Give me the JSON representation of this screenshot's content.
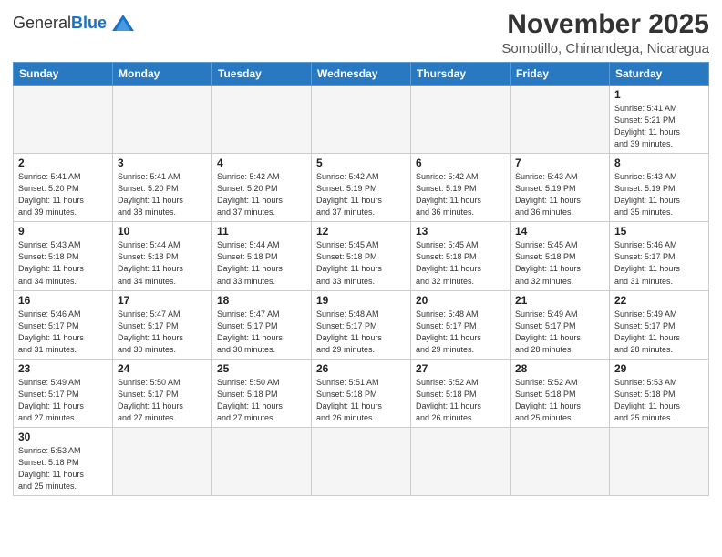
{
  "header": {
    "logo_general": "General",
    "logo_blue": "Blue",
    "title": "November 2025",
    "subtitle": "Somotillo, Chinandega, Nicaragua"
  },
  "weekdays": [
    "Sunday",
    "Monday",
    "Tuesday",
    "Wednesday",
    "Thursday",
    "Friday",
    "Saturday"
  ],
  "weeks": [
    [
      {
        "day": "",
        "info": ""
      },
      {
        "day": "",
        "info": ""
      },
      {
        "day": "",
        "info": ""
      },
      {
        "day": "",
        "info": ""
      },
      {
        "day": "",
        "info": ""
      },
      {
        "day": "",
        "info": ""
      },
      {
        "day": "1",
        "info": "Sunrise: 5:41 AM\nSunset: 5:21 PM\nDaylight: 11 hours\nand 39 minutes."
      }
    ],
    [
      {
        "day": "2",
        "info": "Sunrise: 5:41 AM\nSunset: 5:20 PM\nDaylight: 11 hours\nand 39 minutes."
      },
      {
        "day": "3",
        "info": "Sunrise: 5:41 AM\nSunset: 5:20 PM\nDaylight: 11 hours\nand 38 minutes."
      },
      {
        "day": "4",
        "info": "Sunrise: 5:42 AM\nSunset: 5:20 PM\nDaylight: 11 hours\nand 37 minutes."
      },
      {
        "day": "5",
        "info": "Sunrise: 5:42 AM\nSunset: 5:19 PM\nDaylight: 11 hours\nand 37 minutes."
      },
      {
        "day": "6",
        "info": "Sunrise: 5:42 AM\nSunset: 5:19 PM\nDaylight: 11 hours\nand 36 minutes."
      },
      {
        "day": "7",
        "info": "Sunrise: 5:43 AM\nSunset: 5:19 PM\nDaylight: 11 hours\nand 36 minutes."
      },
      {
        "day": "8",
        "info": "Sunrise: 5:43 AM\nSunset: 5:19 PM\nDaylight: 11 hours\nand 35 minutes."
      }
    ],
    [
      {
        "day": "9",
        "info": "Sunrise: 5:43 AM\nSunset: 5:18 PM\nDaylight: 11 hours\nand 34 minutes."
      },
      {
        "day": "10",
        "info": "Sunrise: 5:44 AM\nSunset: 5:18 PM\nDaylight: 11 hours\nand 34 minutes."
      },
      {
        "day": "11",
        "info": "Sunrise: 5:44 AM\nSunset: 5:18 PM\nDaylight: 11 hours\nand 33 minutes."
      },
      {
        "day": "12",
        "info": "Sunrise: 5:45 AM\nSunset: 5:18 PM\nDaylight: 11 hours\nand 33 minutes."
      },
      {
        "day": "13",
        "info": "Sunrise: 5:45 AM\nSunset: 5:18 PM\nDaylight: 11 hours\nand 32 minutes."
      },
      {
        "day": "14",
        "info": "Sunrise: 5:45 AM\nSunset: 5:18 PM\nDaylight: 11 hours\nand 32 minutes."
      },
      {
        "day": "15",
        "info": "Sunrise: 5:46 AM\nSunset: 5:17 PM\nDaylight: 11 hours\nand 31 minutes."
      }
    ],
    [
      {
        "day": "16",
        "info": "Sunrise: 5:46 AM\nSunset: 5:17 PM\nDaylight: 11 hours\nand 31 minutes."
      },
      {
        "day": "17",
        "info": "Sunrise: 5:47 AM\nSunset: 5:17 PM\nDaylight: 11 hours\nand 30 minutes."
      },
      {
        "day": "18",
        "info": "Sunrise: 5:47 AM\nSunset: 5:17 PM\nDaylight: 11 hours\nand 30 minutes."
      },
      {
        "day": "19",
        "info": "Sunrise: 5:48 AM\nSunset: 5:17 PM\nDaylight: 11 hours\nand 29 minutes."
      },
      {
        "day": "20",
        "info": "Sunrise: 5:48 AM\nSunset: 5:17 PM\nDaylight: 11 hours\nand 29 minutes."
      },
      {
        "day": "21",
        "info": "Sunrise: 5:49 AM\nSunset: 5:17 PM\nDaylight: 11 hours\nand 28 minutes."
      },
      {
        "day": "22",
        "info": "Sunrise: 5:49 AM\nSunset: 5:17 PM\nDaylight: 11 hours\nand 28 minutes."
      }
    ],
    [
      {
        "day": "23",
        "info": "Sunrise: 5:49 AM\nSunset: 5:17 PM\nDaylight: 11 hours\nand 27 minutes."
      },
      {
        "day": "24",
        "info": "Sunrise: 5:50 AM\nSunset: 5:17 PM\nDaylight: 11 hours\nand 27 minutes."
      },
      {
        "day": "25",
        "info": "Sunrise: 5:50 AM\nSunset: 5:18 PM\nDaylight: 11 hours\nand 27 minutes."
      },
      {
        "day": "26",
        "info": "Sunrise: 5:51 AM\nSunset: 5:18 PM\nDaylight: 11 hours\nand 26 minutes."
      },
      {
        "day": "27",
        "info": "Sunrise: 5:52 AM\nSunset: 5:18 PM\nDaylight: 11 hours\nand 26 minutes."
      },
      {
        "day": "28",
        "info": "Sunrise: 5:52 AM\nSunset: 5:18 PM\nDaylight: 11 hours\nand 25 minutes."
      },
      {
        "day": "29",
        "info": "Sunrise: 5:53 AM\nSunset: 5:18 PM\nDaylight: 11 hours\nand 25 minutes."
      }
    ],
    [
      {
        "day": "30",
        "info": "Sunrise: 5:53 AM\nSunset: 5:18 PM\nDaylight: 11 hours\nand 25 minutes."
      },
      {
        "day": "",
        "info": ""
      },
      {
        "day": "",
        "info": ""
      },
      {
        "day": "",
        "info": ""
      },
      {
        "day": "",
        "info": ""
      },
      {
        "day": "",
        "info": ""
      },
      {
        "day": "",
        "info": ""
      }
    ]
  ]
}
